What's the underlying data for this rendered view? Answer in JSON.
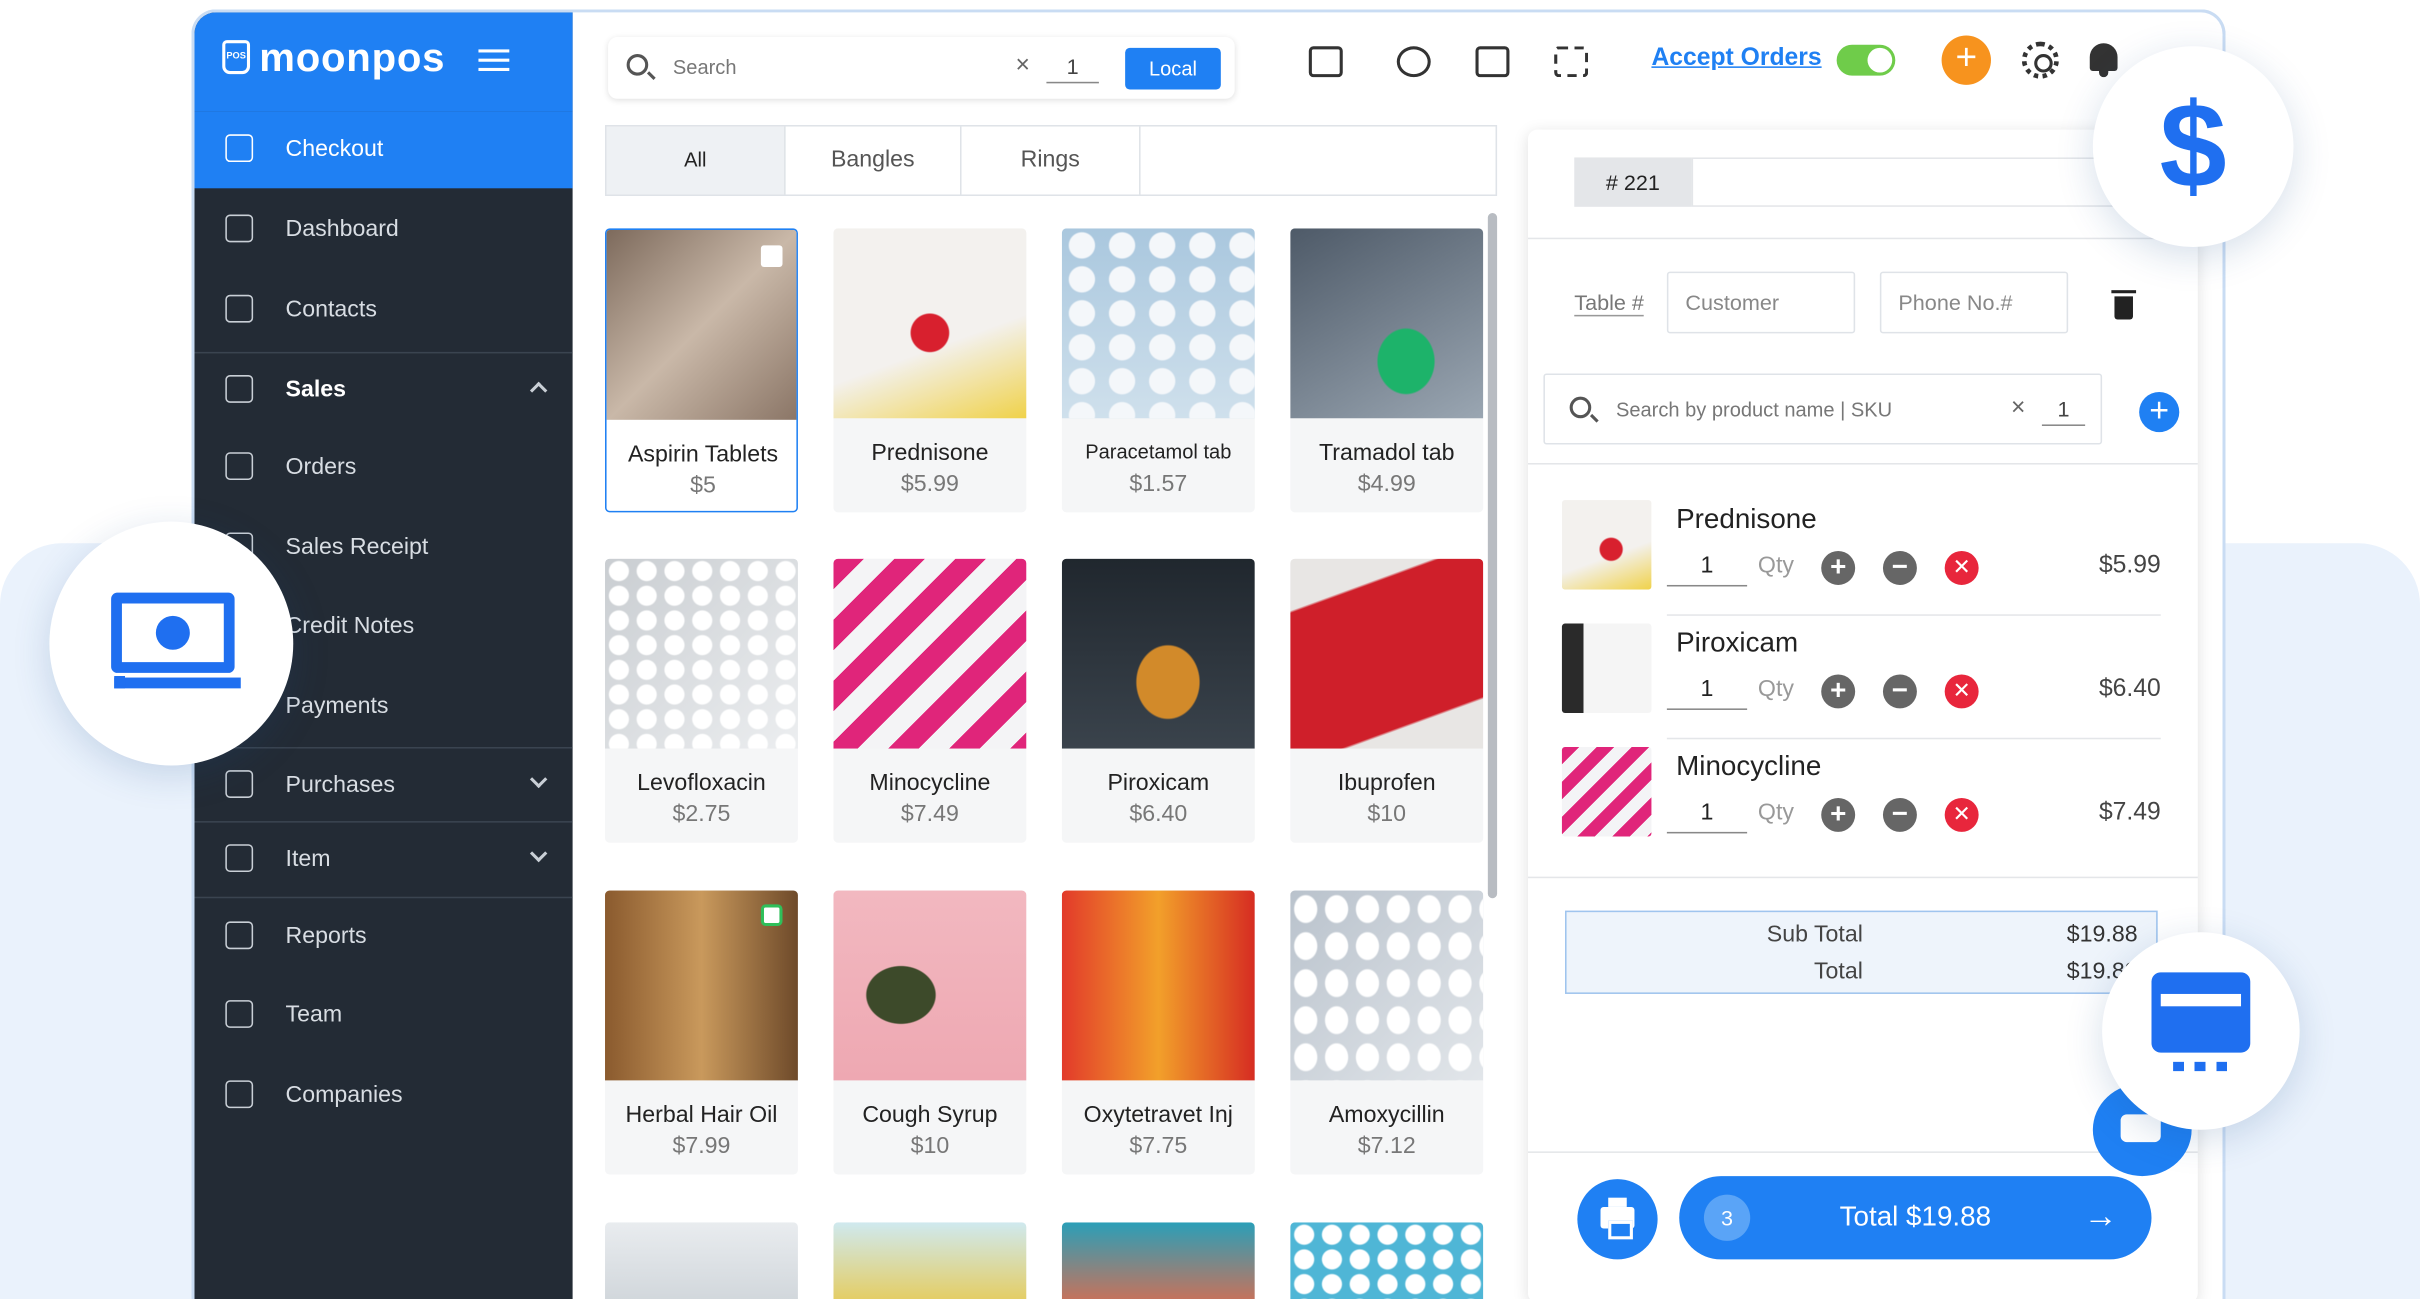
{
  "app": {
    "logo_text": "moonpos",
    "logo_mark": "POS"
  },
  "sidebar": {
    "items": [
      {
        "label": "Checkout",
        "icon": "cart-icon"
      },
      {
        "label": "Dashboard",
        "icon": "home-icon"
      },
      {
        "label": "Contacts",
        "icon": "contacts-icon"
      },
      {
        "label": "Sales",
        "icon": "dollar-file-icon"
      },
      {
        "label": "Orders",
        "icon": "check-square-icon"
      },
      {
        "label": "Sales Receipt",
        "icon": "receipt-icon"
      },
      {
        "label": "Credit Notes",
        "icon": "note-icon"
      },
      {
        "label": "Payments",
        "icon": "payment-icon"
      },
      {
        "label": "Purchases",
        "icon": "bag-icon"
      },
      {
        "label": "Item",
        "icon": "list-icon"
      },
      {
        "label": "Reports",
        "icon": "bar-chart-icon"
      },
      {
        "label": "Team",
        "icon": "team-icon"
      },
      {
        "label": "Companies",
        "icon": "building-icon"
      }
    ]
  },
  "topbar": {
    "search_placeholder": "Search",
    "qty": "1",
    "scope_button": "Local",
    "accept_orders": "Accept Orders",
    "accept_orders_on": true,
    "plus": "+"
  },
  "categories": [
    "All",
    "Bangles",
    "Rings"
  ],
  "products": [
    {
      "name": "Aspirin Tablets",
      "price": "$5"
    },
    {
      "name": "Prednisone",
      "price": "$5.99"
    },
    {
      "name": "Paracetamol tab",
      "price": "$1.57"
    },
    {
      "name": "Tramadol tab",
      "price": "$4.99"
    },
    {
      "name": "Levofloxacin",
      "price": "$2.75"
    },
    {
      "name": "Minocycline",
      "price": "$7.49"
    },
    {
      "name": "Piroxicam",
      "price": "$6.40"
    },
    {
      "name": "Ibuprofen",
      "price": "$10"
    },
    {
      "name": "Herbal Hair Oil",
      "price": "$7.99"
    },
    {
      "name": "Cough Syrup",
      "price": "$10"
    },
    {
      "name": "Oxytetravet Inj",
      "price": "$7.75"
    },
    {
      "name": "Amoxycillin",
      "price": "$7.12"
    }
  ],
  "cart": {
    "order_no": "# 221",
    "table_label": "Table #",
    "customer_placeholder": "Customer",
    "phone_placeholder": "Phone No.#",
    "search_placeholder": "Search by product name | SKU",
    "search_qty": "1",
    "add": "+",
    "qty_label": "Qty",
    "items": [
      {
        "name": "Prednisone",
        "qty": "1",
        "price": "$5.99"
      },
      {
        "name": "Piroxicam",
        "qty": "1",
        "price": "$6.40"
      },
      {
        "name": "Minocycline",
        "qty": "1",
        "price": "$7.49"
      }
    ],
    "subtotal_label": "Sub Total",
    "subtotal_value": "$19.88",
    "total_label": "Total",
    "total_value": "$19.88",
    "item_count": "3",
    "total_button": "Total $19.88",
    "arrow": "→"
  },
  "badges": {
    "dollar": "$"
  },
  "colors": {
    "brand": "#1f80f3",
    "sidebar": "#232b35",
    "accent_orange": "#f7931e",
    "toggle_on": "#6fcc4a",
    "delete_red": "#e8263c"
  }
}
